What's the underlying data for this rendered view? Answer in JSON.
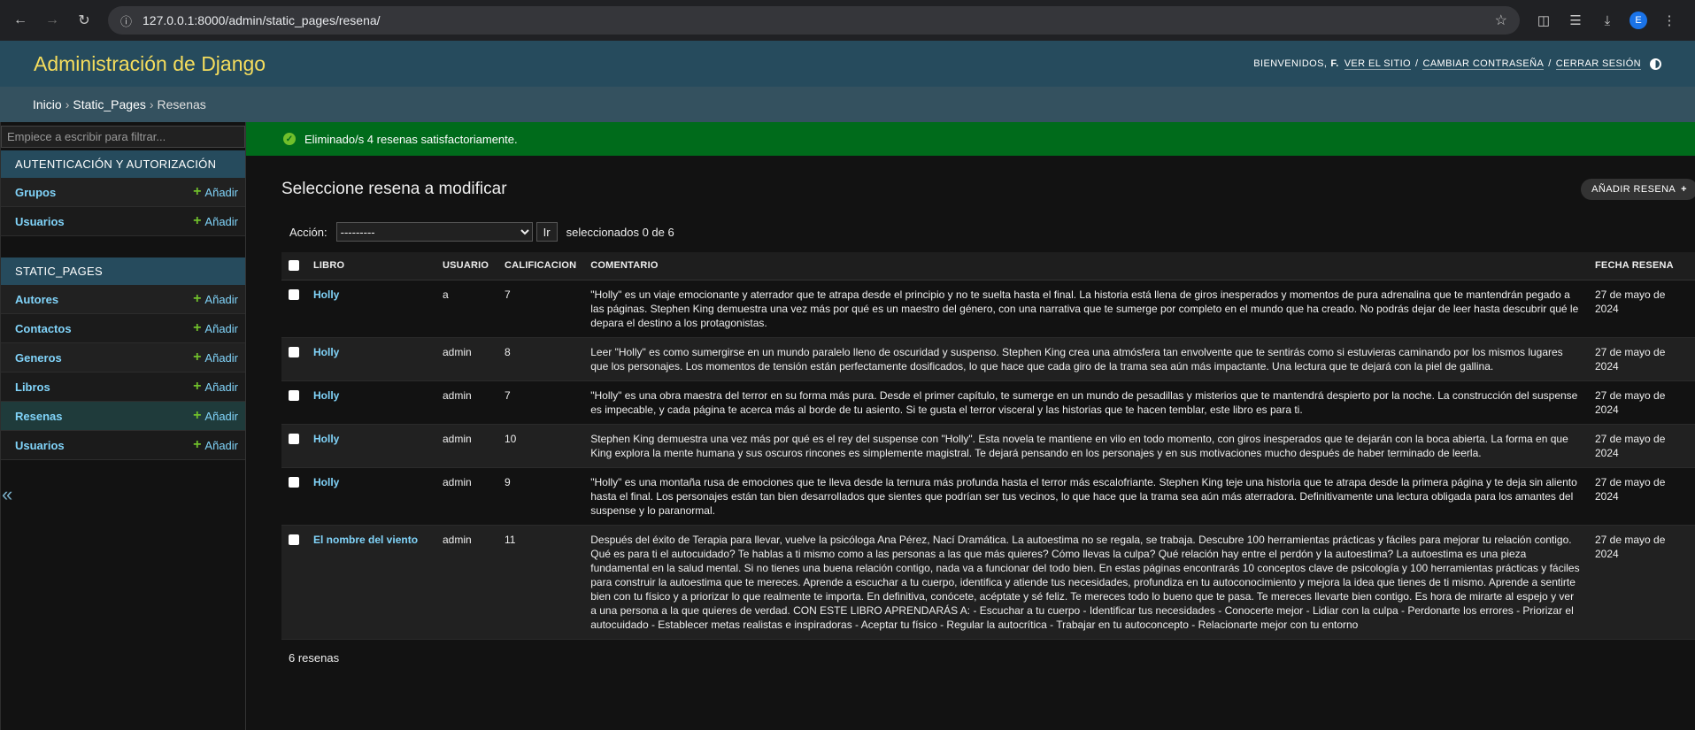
{
  "browser": {
    "url": "127.0.0.1:8000/admin/static_pages/resena/",
    "profile_initial": "E"
  },
  "header": {
    "branding": "Administración de Django",
    "welcome": "BIENVENIDOS,",
    "user": "F.",
    "view_site": "VER EL SITIO",
    "change_password": "CAMBIAR CONTRASEÑA",
    "logout": "CERRAR SESIÓN"
  },
  "breadcrumbs": [
    "Inicio",
    "Static_Pages",
    "Resenas"
  ],
  "sidebar": {
    "filter_placeholder": "Empiece a escribir para filtrar...",
    "add_label": "Añadir",
    "modules": [
      {
        "caption": "AUTENTICACIÓN Y AUTORIZACIÓN",
        "models": [
          "Grupos",
          "Usuarios"
        ]
      },
      {
        "caption": "STATIC_PAGES",
        "models": [
          "Autores",
          "Contactos",
          "Generos",
          "Libros",
          "Resenas",
          "Usuarios"
        ]
      }
    ]
  },
  "message": "Eliminado/s 4 resenas satisfactoriamente.",
  "page_title": "Seleccione resena a modificar",
  "add_button": "AÑADIR RESENA",
  "actions": {
    "label": "Acción:",
    "selected": "---------",
    "go": "Ir",
    "counter": "seleccionados 0 de 6"
  },
  "table": {
    "headers": [
      "LIBRO",
      "USUARIO",
      "CALIFICACION",
      "COMENTARIO",
      "FECHA RESENA"
    ],
    "rows": [
      {
        "libro": "Holly",
        "usuario": "a",
        "calificacion": "7",
        "comentario": "\"Holly\" es un viaje emocionante y aterrador que te atrapa desde el principio y no te suelta hasta el final. La historia está llena de giros inesperados y momentos de pura adrenalina que te mantendrán pegado a las páginas. Stephen King demuestra una vez más por qué es un maestro del género, con una narrativa que te sumerge por completo en el mundo que ha creado. No podrás dejar de leer hasta descubrir qué le depara el destino a los protagonistas.",
        "fecha": "27 de mayo de 2024"
      },
      {
        "libro": "Holly",
        "usuario": "admin",
        "calificacion": "8",
        "comentario": "Leer \"Holly\" es como sumergirse en un mundo paralelo lleno de oscuridad y suspenso. Stephen King crea una atmósfera tan envolvente que te sentirás como si estuvieras caminando por los mismos lugares que los personajes. Los momentos de tensión están perfectamente dosificados, lo que hace que cada giro de la trama sea aún más impactante. Una lectura que te dejará con la piel de gallina.",
        "fecha": "27 de mayo de 2024"
      },
      {
        "libro": "Holly",
        "usuario": "admin",
        "calificacion": "7",
        "comentario": "\"Holly\" es una obra maestra del terror en su forma más pura. Desde el primer capítulo, te sumerge en un mundo de pesadillas y misterios que te mantendrá despierto por la noche. La construcción del suspense es impecable, y cada página te acerca más al borde de tu asiento. Si te gusta el terror visceral y las historias que te hacen temblar, este libro es para ti.",
        "fecha": "27 de mayo de 2024"
      },
      {
        "libro": "Holly",
        "usuario": "admin",
        "calificacion": "10",
        "comentario": "Stephen King demuestra una vez más por qué es el rey del suspense con \"Holly\". Esta novela te mantiene en vilo en todo momento, con giros inesperados que te dejarán con la boca abierta. La forma en que King explora la mente humana y sus oscuros rincones es simplemente magistral. Te dejará pensando en los personajes y en sus motivaciones mucho después de haber terminado de leerla.",
        "fecha": "27 de mayo de 2024"
      },
      {
        "libro": "Holly",
        "usuario": "admin",
        "calificacion": "9",
        "comentario": "\"Holly\" es una montaña rusa de emociones que te lleva desde la ternura más profunda hasta el terror más escalofriante. Stephen King teje una historia que te atrapa desde la primera página y te deja sin aliento hasta el final. Los personajes están tan bien desarrollados que sientes que podrían ser tus vecinos, lo que hace que la trama sea aún más aterradora. Definitivamente una lectura obligada para los amantes del suspense y lo paranormal.",
        "fecha": "27 de mayo de 2024"
      },
      {
        "libro": "El nombre del viento",
        "usuario": "admin",
        "calificacion": "11",
        "comentario": "Después del éxito de Terapia para llevar, vuelve la psicóloga Ana Pérez, Nací Dramática. La autoestima no se regala, se trabaja. Descubre 100 herramientas prácticas y fáciles para mejorar tu relación contigo. Qué es para ti el autocuidado? Te hablas a ti mismo como a las personas a las que más quieres? Cómo llevas la culpa? Qué relación hay entre el perdón y la autoestima? La autoestima es una pieza fundamental en la salud mental. Si no tienes una buena relación contigo, nada va a funcionar del todo bien. En estas páginas encontrarás 10 conceptos clave de psicología y 100 herramientas prácticas y fáciles para construir la autoestima que te mereces. Aprende a escuchar a tu cuerpo, identifica y atiende tus necesidades, profundiza en tu autoconocimiento y mejora la idea que tienes de ti mismo. Aprende a sentirte bien con tu físico y a priorizar lo que realmente te importa. En definitiva, conócete, acéptate y sé feliz. Te mereces todo lo bueno que te pasa. Te mereces llevarte bien contigo. Es hora de mirarte al espejo y ver a una persona a la que quieres de verdad. CON ESTE LIBRO APRENDARÁS A: - Escuchar a tu cuerpo - Identificar tus necesidades - Conocerte mejor - Lidiar con la culpa - Perdonarte los errores - Priorizar el autocuidado - Establecer metas realistas e inspiradoras - Aceptar tu físico - Regular la autocrítica - Trabajar en tu autoconcepto - Relacionarte mejor con tu entorno",
        "fecha": "27 de mayo de 2024"
      }
    ]
  },
  "paginator": "6 resenas"
}
